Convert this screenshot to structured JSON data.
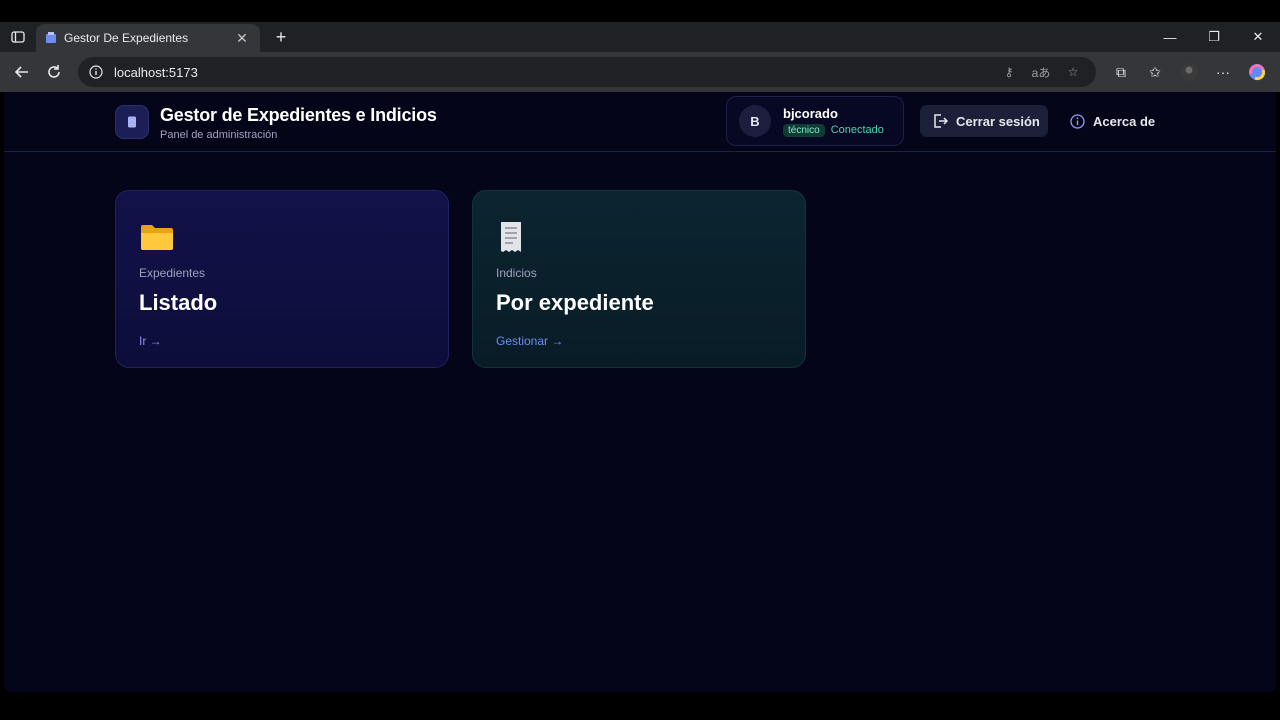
{
  "browser": {
    "tab_title": "Gestor De Expedientes",
    "url": "localhost:5173"
  },
  "header": {
    "title": "Gestor de Expedientes e Indicios",
    "subtitle": "Panel de administración"
  },
  "user": {
    "avatar_initial": "B",
    "username": "bjcorado",
    "role": "técnico",
    "status": "Conectado"
  },
  "actions": {
    "logout_label": "Cerrar sesión",
    "about_label": "Acerca de"
  },
  "cards": [
    {
      "kicker": "Expedientes",
      "title": "Listado",
      "link": "Ir →",
      "icon": "folder-icon"
    },
    {
      "kicker": "Indicios",
      "title": "Por expediente",
      "link": "Gestionar →",
      "icon": "receipt-icon"
    }
  ],
  "colors": {
    "page_bg": "#05051a",
    "accent": "#8f8ff5",
    "status": "#4fd2b0"
  }
}
